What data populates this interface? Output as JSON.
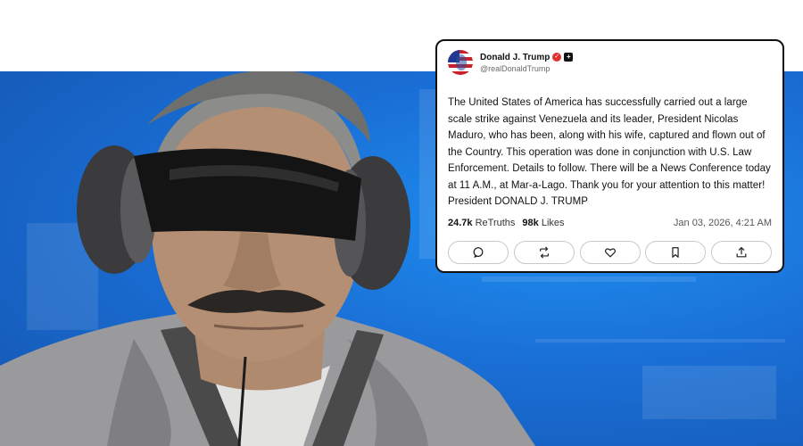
{
  "post": {
    "author": "Donald J. Trump",
    "handle": "@realDonaldTrump",
    "verified_badge_icon": "verified-check-icon",
    "platform_badge_icon": "plus-icon",
    "text": "The United States of America has successfully carried out a large scale strike against Venezuela and its leader, President Nicolas Maduro, who has been, along with his wife, captured and flown out of the Country. This operation was done in conjunction with U.S. Law Enforcement. Details to follow. There will be a News Conference today at 11 A.M., at Mar-a-Lago. Thank you for your attention to this matter! President DONALD J. TRUMP",
    "retruths_count": "24.7k",
    "retruths_label": "ReTruths",
    "likes_count": "98k",
    "likes_label": "Likes",
    "timestamp": "Jan 03, 2026, 4:21 AM",
    "actions": [
      "comment-icon",
      "retruth-icon",
      "like-icon",
      "bookmark-icon",
      "share-icon"
    ]
  },
  "colors": {
    "background_blue": "#1a6fd6",
    "badge_red": "#e0312f",
    "card_border": "#111111"
  }
}
